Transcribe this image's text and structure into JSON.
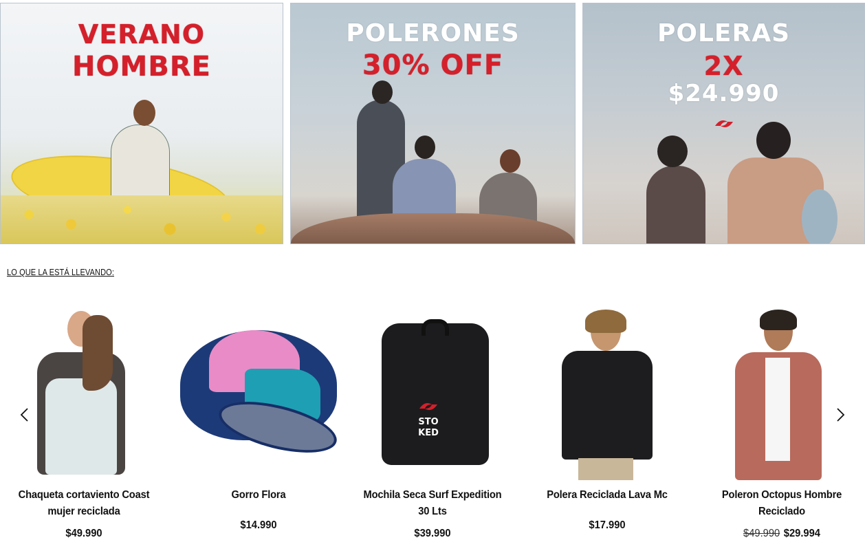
{
  "banners": [
    {
      "line1": "VERANO",
      "line2": "HOMBRE"
    },
    {
      "line1": "POLERONES",
      "line2": "30% OFF"
    },
    {
      "line1": "POLERAS",
      "line2": "2X",
      "line3": "$24.990"
    }
  ],
  "section_title": "LO QUE LA ESTÁ LLEVANDO:",
  "carousel": {
    "products": [
      {
        "name": "Chaqueta cortaviento Coast mujer reciclada",
        "price": "$49.990"
      },
      {
        "name": "Gorro Flora",
        "price": "$14.990"
      },
      {
        "name": "Mochila Seca Surf Expedition 30 Lts",
        "price": "$39.990"
      },
      {
        "name": "Polera Reciclada Lava Mc",
        "price": "$17.990"
      },
      {
        "name": "Poleron Octopus Hombre Reciclado",
        "old_price": "$49.990",
        "price": "$29.994"
      }
    ]
  },
  "colors": {
    "brand_red": "#d4202b",
    "text": "#111111"
  }
}
